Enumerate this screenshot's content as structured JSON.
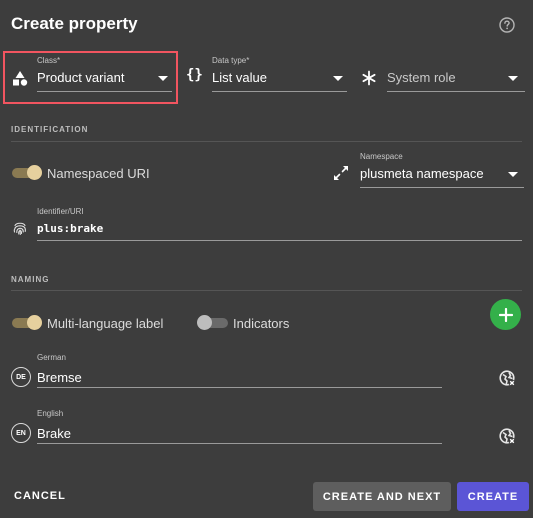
{
  "dialog": {
    "title": "Create property"
  },
  "class_field": {
    "label": "Class*",
    "value": "Product variant",
    "icon": "shapes-icon"
  },
  "datatype_field": {
    "label": "Data type*",
    "value": "List value",
    "icon": "curly-braces-icon"
  },
  "system_role_field": {
    "placeholder": "System role",
    "icon": "asterisk-icon"
  },
  "identification": {
    "section_title": "IDENTIFICATION",
    "namespaced_uri_toggle": {
      "label": "Namespaced URI",
      "on": true
    },
    "namespace_field": {
      "label": "Namespace",
      "value": "plusmeta namespace"
    },
    "identifier_field": {
      "label": "Identifier/URI",
      "value": "plus:brake"
    }
  },
  "naming": {
    "section_title": "NAMING",
    "multi_language_toggle": {
      "label": "Multi-language label",
      "on": true
    },
    "indicators_toggle": {
      "label": "Indicators",
      "on": false
    },
    "languages": [
      {
        "badge": "DE",
        "label": "German",
        "value": "Bremse"
      },
      {
        "badge": "EN",
        "label": "English",
        "value": "Brake"
      }
    ]
  },
  "footer": {
    "cancel_label": "CANCEL",
    "create_next_label": "CREATE AND NEXT",
    "create_label": "CREATE"
  },
  "colors": {
    "background": "#3d3d3d",
    "highlight": "#f25560",
    "toggle_on": "#e6d09e",
    "add_button": "#34b04a",
    "create_button": "#5b55d6",
    "create_next_button": "#5e5e5e"
  }
}
